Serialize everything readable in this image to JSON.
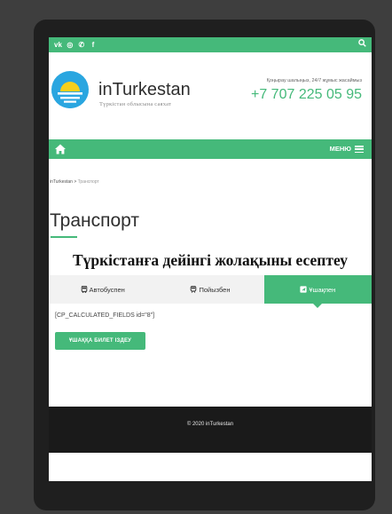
{
  "social": [
    "vk-icon",
    "instagram-icon",
    "whatsapp-icon",
    "facebook-icon"
  ],
  "search_icon": "search-icon",
  "brand": {
    "name": "inTurkestan",
    "tagline": "Түркістан облысына саяхат"
  },
  "contact": {
    "label": "Қоңырау шалыңыз, 24/7 жұмыс жасаймыз",
    "phone": "+7 707 225 05 95"
  },
  "nav": {
    "home_icon": "home-icon",
    "menu_label": "МЕНЮ"
  },
  "breadcrumb": {
    "home": "inTurkestan",
    "separator": ">",
    "current": "Транспорт"
  },
  "page": {
    "title": "Транспорт"
  },
  "calculator": {
    "title": "Түркістанға дейінгі жолақыны есептеу",
    "tabs": [
      {
        "icon": "bus-icon",
        "label": "Автобуспен"
      },
      {
        "icon": "train-icon",
        "label": "Пойызбен"
      },
      {
        "icon": "plane-icon",
        "label": "Ұшақпен"
      }
    ],
    "active_tab": "Ұшақпен",
    "shortcode": "[CP_CALCULATED_FIELDS id=\"8\"]",
    "cta_label": "ҰШАҚҚА БИЛЕТ ІЗДЕУ"
  },
  "footer": {
    "copyright": "© 2020 inTurkestan"
  },
  "colors": {
    "accent": "#45b97a",
    "footer_bg": "#1a1a1a",
    "device": "#1f1f1f",
    "backdrop": "#3e3e3e"
  }
}
